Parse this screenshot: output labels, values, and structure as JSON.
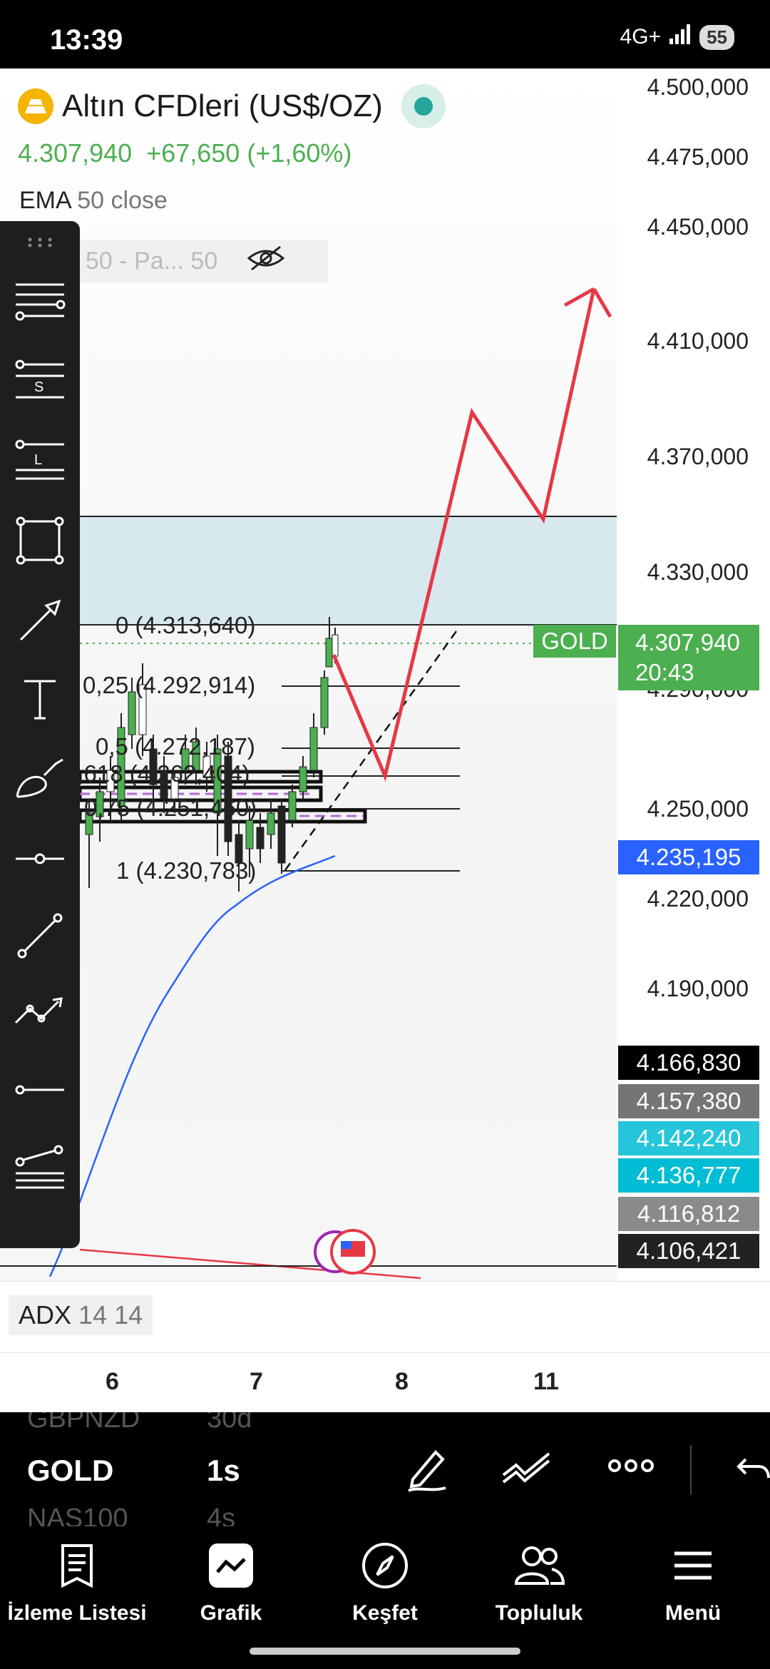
{
  "status_bar": {
    "time": "13:39",
    "network": "4G+",
    "battery": "55"
  },
  "symbol": {
    "name": "Altın CFDleri (US$/OZ)",
    "price": "4.307,940",
    "change": "+67,650",
    "change_pct": "(+1,60%)"
  },
  "indicators": {
    "ema_name": "EMA",
    "ema_params": "50 close",
    "second_legend": "50 - Pa... 50",
    "adx_name": "ADX",
    "adx_params": "14 14"
  },
  "price_axis": {
    "labels": [
      "4.500,000",
      "4.475,000",
      "4.450,000",
      "4.410,000",
      "4.370,000",
      "4.330,000",
      "4.290,000",
      "4.250,000",
      "4.220,000",
      "4.190,000"
    ],
    "current_price": "4.307,940",
    "countdown": "20:43",
    "symbol_tag": "GOLD",
    "blue_tag": "4.235,195",
    "tags": [
      {
        "value": "4.166,830",
        "color": "#000000"
      },
      {
        "value": "4.157,380",
        "color": "#757575"
      },
      {
        "value": "4.142,240",
        "color": "#26c6da"
      },
      {
        "value": "4.136,777",
        "color": "#00bcd4"
      },
      {
        "value": "4.116,812",
        "color": "#8a8a8a"
      },
      {
        "value": "4.106,421",
        "color": "#222222"
      }
    ]
  },
  "fib_levels": {
    "l0": "0 (4.313,640)",
    "l025": "0,25 (4.292,914)",
    "l05": "0,5 (4.272,187)",
    "l0618": "0,618 (4.262,404)",
    "l075": "0,75 (4.251,460)",
    "l1": "1 (4.230,783)"
  },
  "time_axis": [
    "6",
    "7",
    "8",
    "11"
  ],
  "symbol_bar": {
    "prev_symbol": "GBPNZD",
    "prev_interval": "30d",
    "symbol": "GOLD",
    "interval": "1s",
    "next_symbol": "NAS100",
    "next_interval": "4s"
  },
  "bottom_nav": [
    {
      "label": "İzleme Listesi",
      "icon": "watchlist-icon"
    },
    {
      "label": "Grafik",
      "icon": "chart-icon"
    },
    {
      "label": "Keşfet",
      "icon": "compass-icon"
    },
    {
      "label": "Topluluk",
      "icon": "community-icon"
    },
    {
      "label": "Menü",
      "icon": "menu-icon"
    }
  ],
  "colors": {
    "up": "#4caf50",
    "projection": "#e53945",
    "ema": "#2962ff",
    "zone": "#d8e8ef",
    "accent_blue": "#2962ff"
  }
}
